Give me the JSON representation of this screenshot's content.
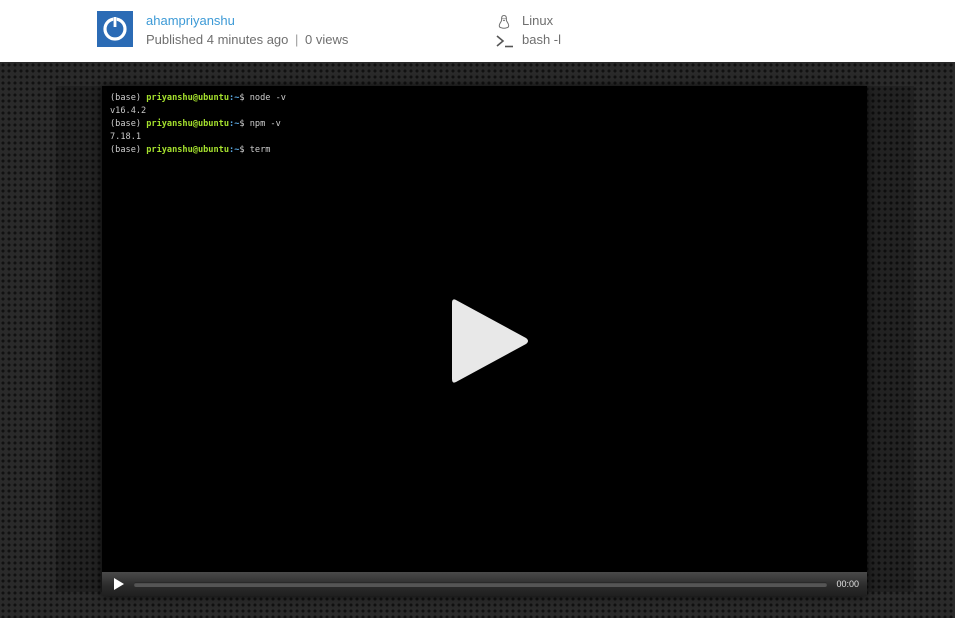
{
  "header": {
    "author": "ahampriyanshu",
    "published_prefix": "Published",
    "published_time": "4 minutes ago",
    "separator": "|",
    "views": "0 views",
    "os_label": "Linux",
    "os_icon": "tux-penguin-icon",
    "shell_label": "bash -l",
    "shell_icon": "terminal-prompt-icon",
    "avatar_color": "#2b6bb5"
  },
  "terminal": {
    "lines": [
      {
        "env": "(base) ",
        "user": "priyanshu@ubuntu",
        "path": ":~",
        "prompt": "$ ",
        "command": "node -v"
      },
      {
        "output": "v16.4.2"
      },
      {
        "env": "(base) ",
        "user": "priyanshu@ubuntu",
        "path": ":~",
        "prompt": "$ ",
        "command": "npm -v"
      },
      {
        "output": "7.18.1"
      },
      {
        "env": "(base) ",
        "user": "priyanshu@ubuntu",
        "path": ":~",
        "prompt": "$ ",
        "command": "term"
      }
    ]
  },
  "player": {
    "time": "00:00",
    "progress": 0,
    "big_play_icon": "play-icon",
    "control_play_icon": "play-icon",
    "accent": "#e8e8e8"
  }
}
